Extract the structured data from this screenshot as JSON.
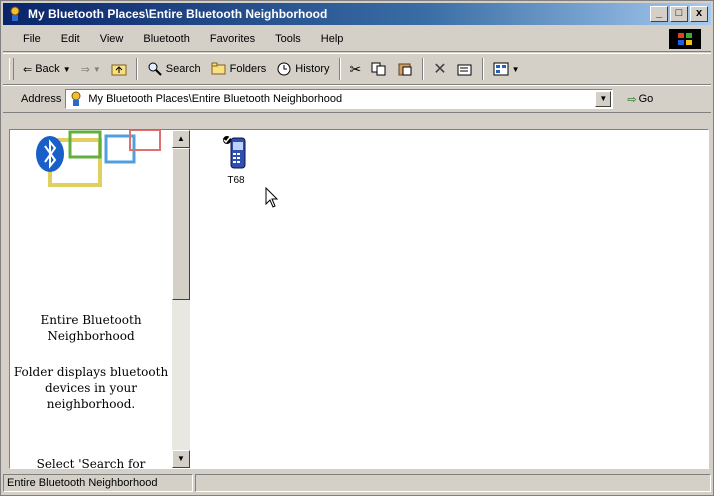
{
  "window": {
    "title": "My Bluetooth Places\\Entire Bluetooth Neighborhood",
    "minimize": "_",
    "maximize": "□",
    "close": "x"
  },
  "menu": [
    "File",
    "Edit",
    "View",
    "Bluetooth",
    "Favorites",
    "Tools",
    "Help"
  ],
  "toolbar": {
    "back": "Back",
    "search": "Search",
    "folders": "Folders",
    "history": "History"
  },
  "address": {
    "label": "Address",
    "value": "My Bluetooth Places\\Entire Bluetooth Neighborhood",
    "go": "Go"
  },
  "left_pane": {
    "folder_title": "Entire Bluetooth Neighborhood",
    "folder_description": "Folder displays bluetooth devices in your neighborhood.",
    "hint": "Select 'Search for"
  },
  "devices": [
    {
      "label": "T68",
      "icon": "mobile-phone-icon"
    }
  ],
  "statusbar": {
    "text": "Entire Bluetooth Neighborhood"
  },
  "colors": {
    "titlebar_start": "#0a246a",
    "titlebar_end": "#a6caf0",
    "bluetooth_blue": "#1a5fc8"
  }
}
